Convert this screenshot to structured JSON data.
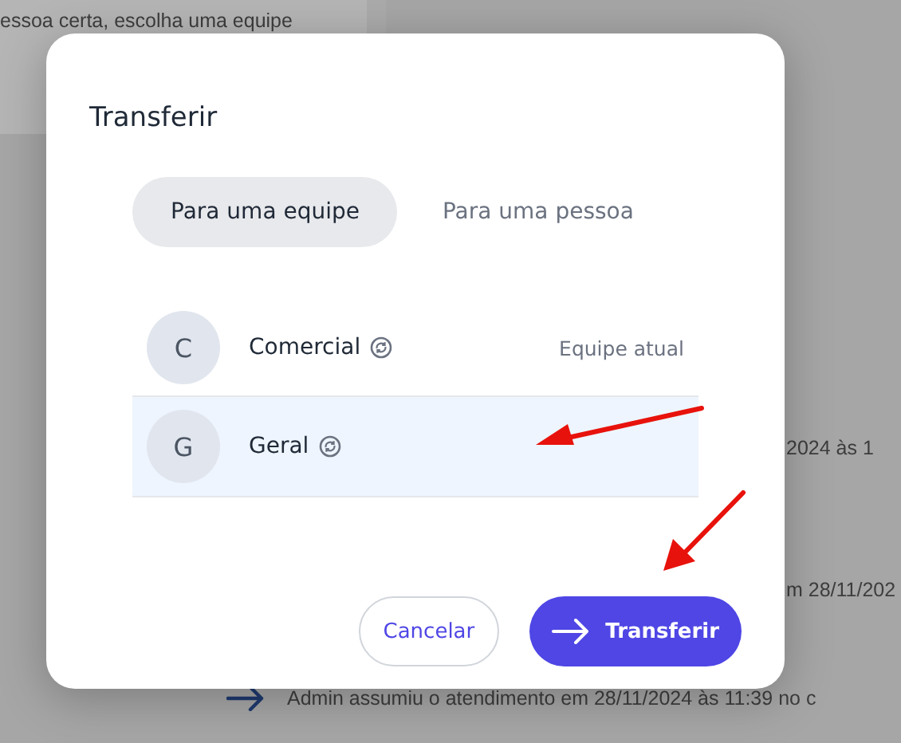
{
  "background": {
    "top_text": "essoa certa, escolha uma equipe",
    "side_texts": [
      "2024 às 1",
      "m 28/11/202"
    ],
    "event_text": "Admin assumiu o atendimento em 28/11/2024 às 11:39 no c"
  },
  "dialog": {
    "title": "Transferir",
    "tabs": [
      {
        "label": "Para uma equipe",
        "selected": true
      },
      {
        "label": "Para uma pessoa",
        "selected": false
      }
    ],
    "teams": [
      {
        "initial": "C",
        "name": "Comercial",
        "note": "Equipe atual",
        "selected": false
      },
      {
        "initial": "G",
        "name": "Geral",
        "selected": true
      }
    ],
    "cancel_button": "Cancelar",
    "confirm_button": "Transferir"
  }
}
